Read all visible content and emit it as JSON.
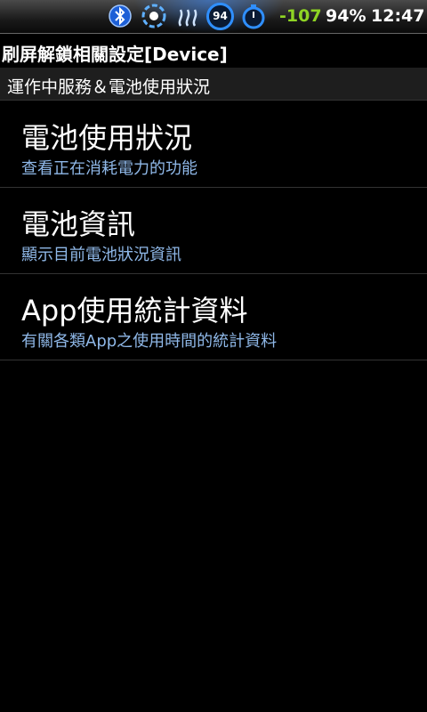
{
  "status_bar": {
    "icons": [
      "bluetooth-icon",
      "aperture-icon",
      "heat-waves-icon",
      "battery-circle-icon",
      "stopwatch-icon"
    ],
    "battery_badge": "94",
    "signal_strength": "-107",
    "battery_percent": "94%",
    "time": "12:47",
    "signal_color": "#8fd424"
  },
  "title_bar": {
    "title": "刷屏解鎖相關設定[Device]"
  },
  "section": {
    "header": "運作中服務＆電池使用狀況"
  },
  "list": {
    "items": [
      {
        "title": "電池使用狀況",
        "subtitle": "查看正在消耗電力的功能"
      },
      {
        "title": "電池資訊",
        "subtitle": "顯示目前電池狀況資訊"
      },
      {
        "title": "App使用統計資料",
        "subtitle": "有關各類App之使用時間的統計資料"
      }
    ]
  },
  "colors": {
    "background": "#000000",
    "subtitle": "#8fb8e8",
    "accent_blue": "#2f8fff"
  }
}
